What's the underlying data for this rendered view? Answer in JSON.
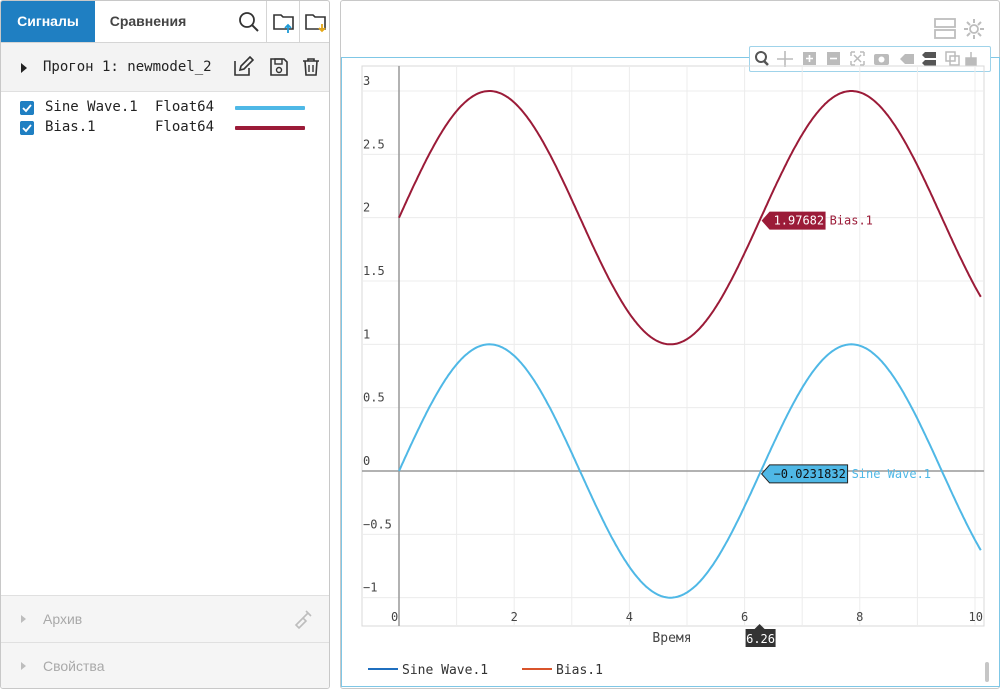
{
  "tabs": {
    "signals": "Сигналы",
    "compare": "Сравнения"
  },
  "icons": {
    "search": "search-icon",
    "import": "folder-import-icon",
    "export": "folder-export-icon",
    "edit": "edit-icon",
    "save": "save-icon",
    "delete": "trash-icon",
    "clear": "broom-icon",
    "layout": "layout-icon",
    "settings": "gear-icon"
  },
  "run": {
    "label": "Прогон 1: newmodel_2"
  },
  "signals": [
    {
      "name": "Sine Wave.1",
      "type": "Float64",
      "color": "#4fb8e6"
    },
    {
      "name": "Bias.1",
      "type": "Float64",
      "color": "#9b1b38"
    }
  ],
  "sections": {
    "archive": "Архив",
    "properties": "Свойства"
  },
  "chart_data": {
    "type": "line",
    "xlabel": "Время",
    "xlim": [
      0,
      10.1
    ],
    "ylim": [
      -1.2,
      3.2
    ],
    "xticks": [
      "0",
      "2",
      "4",
      "6",
      "8",
      "10"
    ],
    "yticks": [
      "3",
      "2.5",
      "2",
      "1.5",
      "1",
      "0.5",
      "0",
      "−0.5",
      "−1"
    ],
    "grid": true,
    "cursor": {
      "x": 6.26,
      "label": "6.26"
    },
    "series": [
      {
        "name": "Sine Wave.1",
        "color": "#4fb8e6",
        "legend_color": "#1f6fbf",
        "function": "sin(t)",
        "cursor_value": "−0.0231832"
      },
      {
        "name": "Bias.1",
        "color": "#9b1b38",
        "legend_color": "#d9542b",
        "function": "2+sin(t)",
        "cursor_value": "1.97682"
      }
    ]
  }
}
